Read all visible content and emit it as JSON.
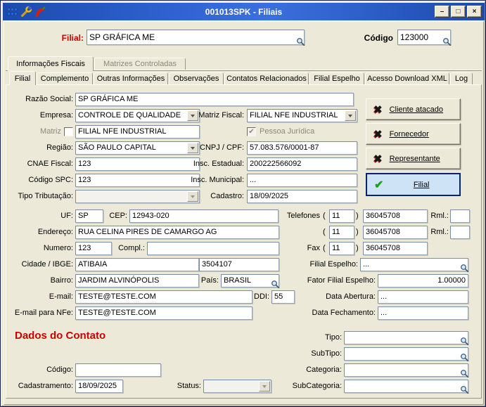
{
  "window": {
    "title": "001013SPK - Filiais",
    "controls": {
      "minimize": "–",
      "maximize": "□",
      "close": "×"
    }
  },
  "titlebar_icons": [
    "app-icon",
    "tools-icon",
    "pepper-icon"
  ],
  "icons": {
    "x_mark": "✖",
    "check_mark": "✔",
    "lookup": "magnifier"
  },
  "header": {
    "filial_label": "Filial:",
    "filial_value": "SP GRÁFICA ME",
    "codigo_label": "Código",
    "codigo_value": "123000"
  },
  "tabs": {
    "outer": [
      {
        "label": "Informações Fiscais",
        "state": "active"
      },
      {
        "label": "Matrizes Controladas",
        "state": "disabled"
      }
    ],
    "inner": [
      {
        "label": "Filial",
        "state": "active"
      },
      {
        "label": "Complemento",
        "state": "normal"
      },
      {
        "label": "Outras Informações",
        "state": "normal"
      },
      {
        "label": "Observações",
        "state": "normal"
      },
      {
        "label": "Contatos Relacionados",
        "state": "normal"
      },
      {
        "label": "Filial Espelho",
        "state": "normal"
      },
      {
        "label": "Acesso Download XML",
        "state": "normal"
      },
      {
        "label": "Log",
        "state": "normal"
      }
    ]
  },
  "form": {
    "razao_social": {
      "label": "Razão Social:",
      "value": "SP GRÁFICA ME"
    },
    "empresa": {
      "label": "Empresa:",
      "value": "CONTROLE DE QUALIDADE"
    },
    "matriz_fiscal": {
      "label": "Matriz Fiscal:",
      "value": "FILIAL NFE INDUSTRIAL"
    },
    "matriz": {
      "label": "Matriz",
      "value": "FILIAL NFE INDUSTRIAL",
      "checked": false
    },
    "pessoa_juridica": {
      "label": "Pessoa Jurídica",
      "checked": true
    },
    "regiao": {
      "label": "Região:",
      "value": "SÃO PAULO CAPITAL"
    },
    "cnpj_cpf": {
      "label": "CNPJ / CPF:",
      "value": "57.083.576/0001-87"
    },
    "cnae_fiscal": {
      "label": "CNAE Fiscal:",
      "value": "123"
    },
    "insc_estadual": {
      "label": "Insc. Estadual:",
      "value": "200222566092"
    },
    "codigo_spc": {
      "label": "Código SPC:",
      "value": "123"
    },
    "insc_municipal": {
      "label": "Insc. Municipal:",
      "value": "..."
    },
    "tipo_tributacao": {
      "label": "Tipo Tributação:",
      "value": ""
    },
    "cadastro": {
      "label": "Cadastro:",
      "value": "18/09/2025"
    }
  },
  "roles": [
    {
      "label": "Cliente atacado",
      "state": "off"
    },
    {
      "label": "Fornecedor",
      "state": "off"
    },
    {
      "label": "Representante",
      "state": "off"
    },
    {
      "label": "Filial",
      "state": "on"
    }
  ],
  "address": {
    "uf": {
      "label": "UF:",
      "value": "SP"
    },
    "cep": {
      "label": "CEP:",
      "value": "12943-020"
    },
    "telefones_label": "Telefones",
    "paren_open": "(",
    "paren_close": ")",
    "rml_label": "Rml.:",
    "phone1": {
      "ddd": "11",
      "number": "36045708",
      "rml": ""
    },
    "phone2": {
      "ddd": "11",
      "number": "36045708",
      "rml": ""
    },
    "fax_label": "Fax",
    "fax": {
      "ddd": "11",
      "number": "36045708"
    },
    "endereco": {
      "label": "Endereço:",
      "value": "RUA CELINA PIRES DE CAMARGO AG"
    },
    "numero": {
      "label": "Numero:",
      "value": "123"
    },
    "compl": {
      "label": "Compl.:",
      "value": ""
    },
    "cidade_ibge": {
      "label": "Cidade / IBGE:",
      "cidade": "ATIBAIA",
      "ibge": "3504107"
    },
    "filial_espelho": {
      "label": "Filial Espelho:",
      "value": "..."
    },
    "bairro": {
      "label": "Bairro:",
      "value": "JARDIM ALVINÓPOLIS"
    },
    "pais": {
      "label": "País:",
      "value": "BRASIL"
    },
    "fator_filial_espelho": {
      "label": "Fator Filial Espelho:",
      "value": "1.00000"
    },
    "email": {
      "label": "E-mail:",
      "value": "TESTE@TESTE.COM"
    },
    "ddi": {
      "label": "DDI:",
      "value": "55"
    },
    "data_abertura": {
      "label": "Data Abertura:",
      "value": "..."
    },
    "email_nfe": {
      "label": "E-mail para NFe:",
      "value": "TESTE@TESTE.COM"
    },
    "data_fechamento": {
      "label": "Data Fechamento:",
      "value": "..."
    }
  },
  "contato": {
    "heading": "Dados do Contato",
    "tipo": {
      "label": "Tipo:",
      "value": ""
    },
    "subtipo": {
      "label": "SubTipo:",
      "value": ""
    },
    "codigo": {
      "label": "Código:",
      "value": ""
    },
    "categoria": {
      "label": "Categoria:",
      "value": ""
    },
    "cadastramento": {
      "label": "Cadastramento:",
      "value": "18/09/2025"
    },
    "status": {
      "label": "Status:",
      "value": ""
    },
    "subcategoria": {
      "label": "SubCategoria:",
      "value": ""
    }
  },
  "colors": {
    "titlebar_blue": "#2f62d0",
    "label_red": "#cc0000",
    "selected_role_bg": "#cfe3f7",
    "selected_role_border": "#0a246a",
    "dialog_bg": "#ece9d8"
  }
}
